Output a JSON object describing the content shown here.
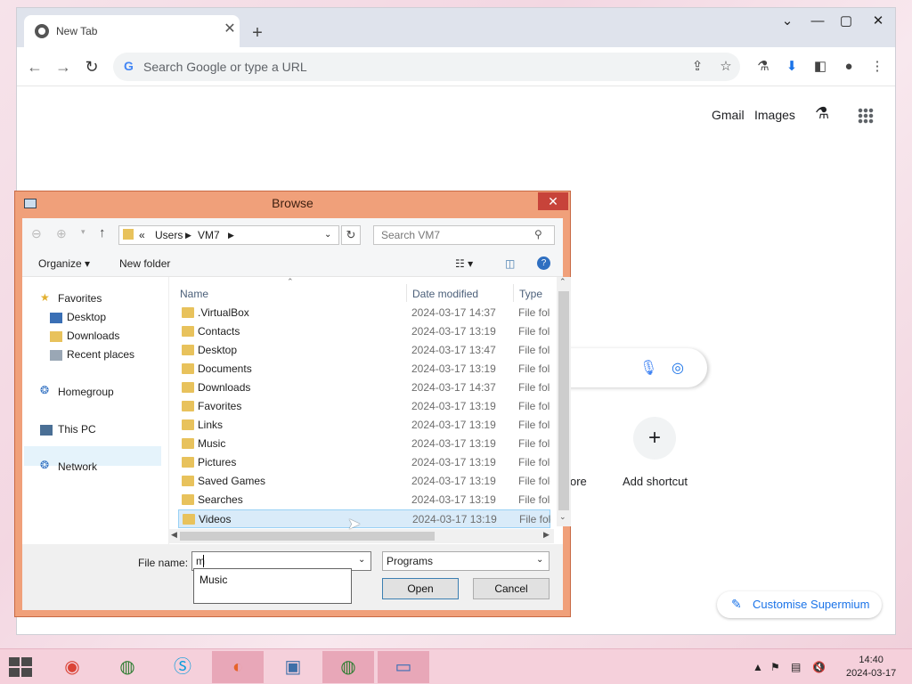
{
  "browser": {
    "tab_title": "New Tab",
    "omnibox_placeholder": "Search Google or type a URL",
    "header_links": [
      "Gmail",
      "Images"
    ],
    "add_shortcut_label": "Add shortcut",
    "partial_shortcut_label": "ore",
    "customise_label": "Customise Supermium"
  },
  "dialog": {
    "title": "Browse",
    "breadcrumb": [
      "«",
      "Users",
      "VM7"
    ],
    "search_placeholder": "Search VM7",
    "organize_label": "Organize",
    "new_folder_label": "New folder",
    "nav": {
      "favorites": "Favorites",
      "favorites_items": [
        "Desktop",
        "Downloads",
        "Recent places"
      ],
      "homegroup": "Homegroup",
      "this_pc": "This PC",
      "network": "Network"
    },
    "columns": {
      "name": "Name",
      "date": "Date modified",
      "type": "Type"
    },
    "files": [
      {
        "name": ".VirtualBox",
        "date": "2024-03-17 14:37",
        "type": "File folder"
      },
      {
        "name": "Contacts",
        "date": "2024-03-17 13:19",
        "type": "File folder"
      },
      {
        "name": "Desktop",
        "date": "2024-03-17 13:47",
        "type": "File folder"
      },
      {
        "name": "Documents",
        "date": "2024-03-17 13:19",
        "type": "File folder"
      },
      {
        "name": "Downloads",
        "date": "2024-03-17 14:37",
        "type": "File folder"
      },
      {
        "name": "Favorites",
        "date": "2024-03-17 13:19",
        "type": "File folder"
      },
      {
        "name": "Links",
        "date": "2024-03-17 13:19",
        "type": "File folder"
      },
      {
        "name": "Music",
        "date": "2024-03-17 13:19",
        "type": "File folder"
      },
      {
        "name": "Pictures",
        "date": "2024-03-17 13:19",
        "type": "File folder"
      },
      {
        "name": "Saved Games",
        "date": "2024-03-17 13:19",
        "type": "File folder"
      },
      {
        "name": "Searches",
        "date": "2024-03-17 13:19",
        "type": "File folder"
      },
      {
        "name": "Videos",
        "date": "2024-03-17 13:19",
        "type": "File folder"
      }
    ],
    "selected_row": "Videos",
    "file_name_label": "File name:",
    "file_name_value": "m",
    "file_type_value": "Programs",
    "autocomplete_items": [
      "Music"
    ],
    "open_label": "Open",
    "cancel_label": "Cancel"
  },
  "taskbar": {
    "time": "14:40",
    "date": "2024-03-17"
  }
}
